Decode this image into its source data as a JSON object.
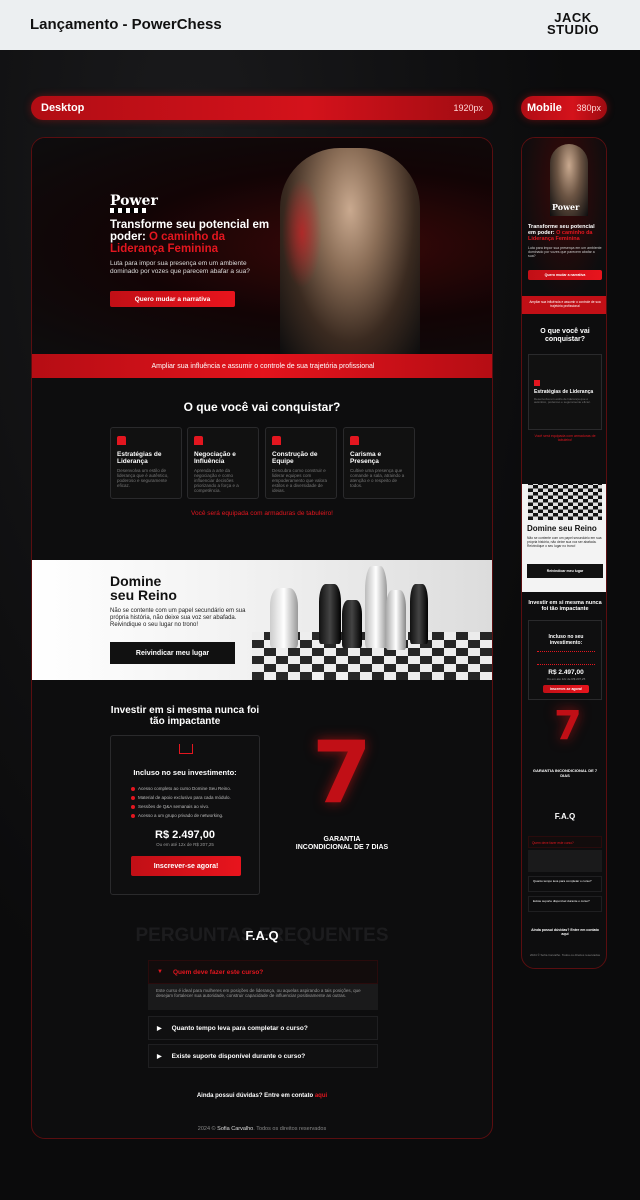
{
  "header": {
    "title": "Lançamento - PowerChess",
    "brand": [
      "JACK",
      "STUDIO"
    ]
  },
  "labels": {
    "desktop": "Desktop",
    "desktop_px": "1920px",
    "mobile": "Mobile",
    "mobile_px": "380px"
  },
  "hero": {
    "logo": "Power",
    "headline_1": "Transforme seu potencial em poder: ",
    "headline_red": "O caminho da Liderança Feminina",
    "sub": "Luta para impor sua presença em um ambiente dominado por vozes que parecem abafar a sua?",
    "cta": "Quero mudar a narrativa"
  },
  "band": "Ampliar sua influência e assumir o controle de sua trajetória profissional",
  "conquer": {
    "title": "O que você vai conquistar?",
    "cards": [
      {
        "title": "Estratégias de Liderança",
        "desc": "Desenvolva um estilo de liderança que é autêntico, poderoso e seguramente eficaz."
      },
      {
        "title": "Negociação e Influência",
        "desc": "Aprenda a arte da negociação e como influenciar decisões priorizando a força e a competência."
      },
      {
        "title": "Construção de Equipe",
        "desc": "Descubra como construir e liderar equipes com empoderamento que valora estilos e a diversidade de ideias."
      },
      {
        "title": "Carisma e Presença",
        "desc": "Cultive uma presença que comande a sala, atraindo a atenção e o respeito de todos."
      }
    ],
    "link": "Você será equipada com armaduras de tabuleiro!"
  },
  "reino": {
    "title_1": "Domine",
    "title_2": "seu Reino",
    "text": "Não se contente com um papel secundário em sua própria história, não deixe sua voz ser abafada. Reivindique o seu lugar no trono!",
    "cta": "Reivindicar meu lugar"
  },
  "invest": {
    "title": "Investir em si mesma nunca foi tão impactante",
    "box_title": "Incluso no seu investimento:",
    "items": [
      "Acesso completo ao curso Domine Seu Reino.",
      "Material de apoio exclusivo para cada módulo.",
      "Sessões de Q&A semanais ao vivo.",
      "Acesso a um grupo privado de networking."
    ],
    "price": "R$ 2.497,00",
    "installments": "Ou em até 12x de R$ 207,25",
    "cta": "Inscrever-se agora!"
  },
  "guarantee": {
    "number": "7",
    "text_1": "GARANTIA",
    "text_2": "INCONDICIONAL DE 7 DIAS"
  },
  "faq": {
    "title": "F.A.Q",
    "bg_text": "PERGUNTAS FREQUENTES",
    "items": [
      {
        "q": "Quem deve fazer este curso?",
        "a": "Este curso é ideal para mulheres em posições de liderança, ou aquelas aspirando a tais posições, que desejam fortalecer sua autoridade, construir capacidade de influenciar positivamente as outras."
      },
      {
        "q": "Quanto tempo leva para completar o curso?"
      },
      {
        "q": "Existe suporte disponível durante o curso?"
      }
    ],
    "contact_text": "Ainda possui dúvidas? Entre em contato ",
    "contact_link": "aqui"
  },
  "footer": {
    "year": "2024 © ",
    "name": "Sofia Carvalho",
    "rights": ". Todos os direitos reservados"
  },
  "mobile": {
    "headline_1": "Transforme seu potencial em poder: ",
    "headline_red": "O caminho da Liderança Feminina",
    "sub": "Luta para impor sua presença em um ambiente dominado por vozes que parecem abafar a sua?",
    "cta": "Quero mudar a narrativa",
    "band": "Ampliar sua influência e assumir o controle de sua trajetória profissional",
    "conquer_title": "O que você vai conquistar?",
    "card_title": "Estratégias de Liderança",
    "card_desc": "Desenvolva um estilo de liderança que é autêntico, poderoso e seguramente eficaz.",
    "link": "Você será equipada com armaduras de tabuleiro!",
    "reino_title": "Domine seu Reino",
    "reino_text": "Não se contente com um papel secundário em sua própria história, não deixe sua voz ser abafada. Reivindique o seu lugar no trono!",
    "reino_cta": "Reivindicar meu lugar",
    "invest_title": "Investir em si mesma nunca foi tão impactante",
    "box_title": "Incluso no seu investimento:",
    "price": "R$ 2.497,00",
    "installments": "Ou em até 12x de R$ 207,25",
    "invest_cta": "Inscrever-se agora!",
    "guarantee": "GARANTIA INCONDICIONAL DE 7 DIAS",
    "faq_title": "F.A.Q",
    "faq_1": "Quem deve fazer este curso?",
    "faq_2": "Quanto tempo leva para completar o curso?",
    "faq_3": "Existe suporte disponível durante o curso?",
    "contact": "Ainda possui dúvidas? Entre em contato aqui",
    "footer": "2024 © Sofia Carvalho. Todos os direitos reservados"
  },
  "colors": {
    "accent": "#e3161f",
    "dark": "#0d0d0e",
    "band": "#c10f16"
  }
}
